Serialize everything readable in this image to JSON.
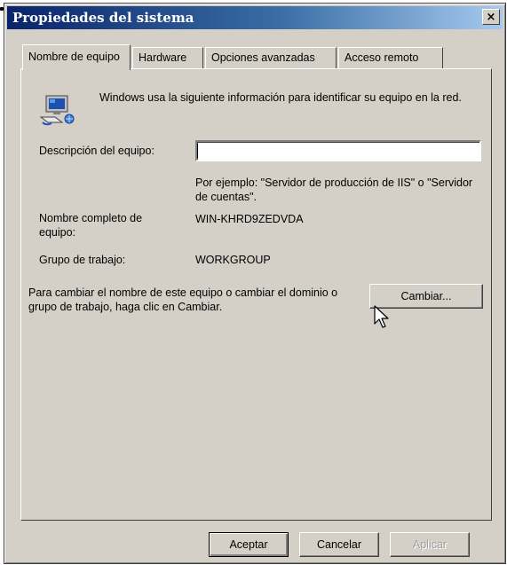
{
  "window": {
    "title": "Propiedades del sistema",
    "close_glyph": "×"
  },
  "tabs": [
    {
      "label": "Nombre de equipo",
      "active": true
    },
    {
      "label": "Hardware",
      "active": false
    },
    {
      "label": "Opciones avanzadas",
      "active": false
    },
    {
      "label": "Acceso remoto",
      "active": false
    }
  ],
  "panel": {
    "intro_icon": "computer-network-icon",
    "intro_text": "Windows usa la siguiente información para identificar su equipo en la red.",
    "description_label": "Descripción del equipo:",
    "description_value": "",
    "example_text": "Por ejemplo: \"Servidor de producción de IIS\" o \"Servidor de cuentas\".",
    "full_name_label": "Nombre completo de equipo:",
    "full_name_value": "WIN-KHRD9ZEDVDA",
    "workgroup_label": "Grupo de trabajo:",
    "workgroup_value": "WORKGROUP",
    "change_hint": "Para cambiar el nombre de este equipo o cambiar el dominio o grupo de trabajo, haga clic en Cambiar.",
    "change_button": "Cambiar..."
  },
  "footer": {
    "ok": "Aceptar",
    "cancel": "Cancelar",
    "apply": "Aplicar",
    "apply_enabled": false
  },
  "colors": {
    "title_gradient_start": "#0a246a",
    "title_gradient_end": "#a6caf0",
    "face": "#d4d0c8"
  }
}
